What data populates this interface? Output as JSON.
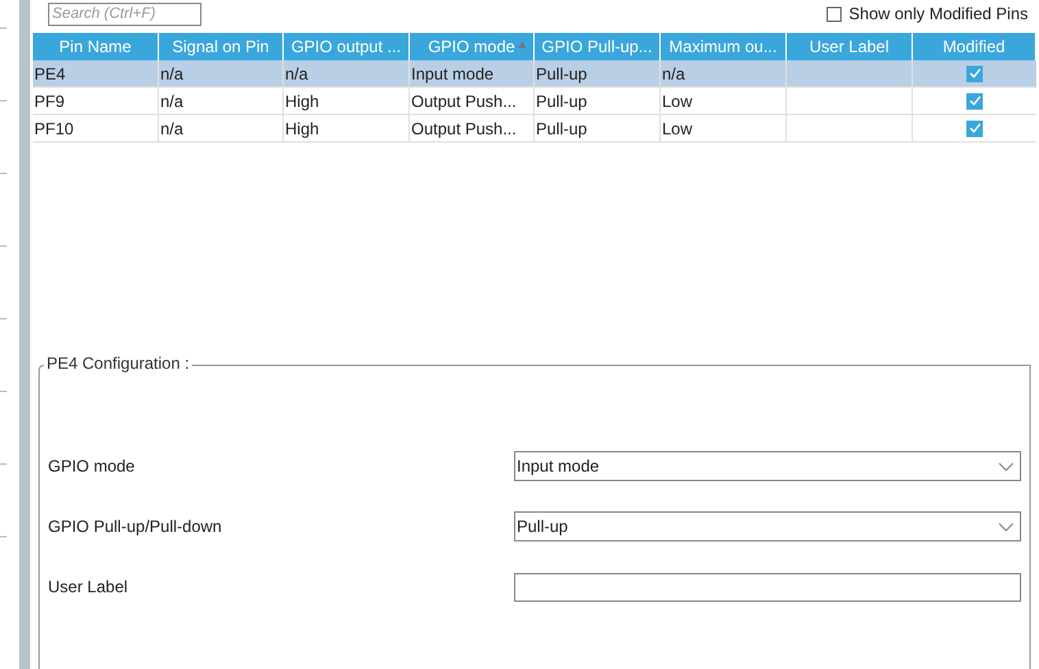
{
  "search": {
    "placeholder": "Search (Ctrl+F)"
  },
  "filter": {
    "label": "Show only Modified Pins",
    "checked": false
  },
  "table": {
    "columns": [
      {
        "label": "Pin Name",
        "sorted": false
      },
      {
        "label": "Signal on Pin",
        "sorted": false
      },
      {
        "label": "GPIO output ...",
        "sorted": false
      },
      {
        "label": "GPIO mode",
        "sorted": true
      },
      {
        "label": "GPIO Pull-up...",
        "sorted": false
      },
      {
        "label": "Maximum ou...",
        "sorted": false
      },
      {
        "label": "User Label",
        "sorted": false
      },
      {
        "label": "Modified",
        "sorted": false
      }
    ],
    "rows": [
      {
        "cells": [
          "PE4",
          "n/a",
          "n/a",
          "Input mode",
          "Pull-up",
          "n/a",
          null
        ],
        "modified": true,
        "selected": true
      },
      {
        "cells": [
          "PF9",
          "n/a",
          "High",
          "Output Push...",
          "Pull-up",
          "Low",
          null
        ],
        "modified": true,
        "selected": false
      },
      {
        "cells": [
          "PF10",
          "n/a",
          "High",
          "Output Push...",
          "Pull-up",
          "Low",
          null
        ],
        "modified": true,
        "selected": false
      }
    ]
  },
  "config": {
    "title": "PE4 Configuration :",
    "fields": [
      {
        "kind": "select",
        "label": "GPIO mode",
        "value": "Input mode"
      },
      {
        "kind": "select",
        "label": "GPIO Pull-up/Pull-down",
        "value": "Pull-up"
      },
      {
        "kind": "text",
        "label": "User Label"
      }
    ]
  }
}
